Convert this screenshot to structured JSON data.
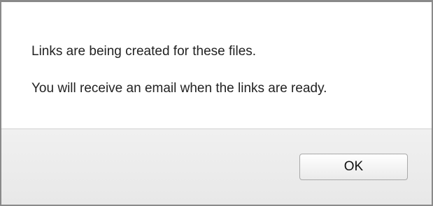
{
  "dialog": {
    "messages": [
      "Links are being created for these files.",
      "You will receive an email when the links are ready."
    ],
    "ok_label": "OK"
  }
}
